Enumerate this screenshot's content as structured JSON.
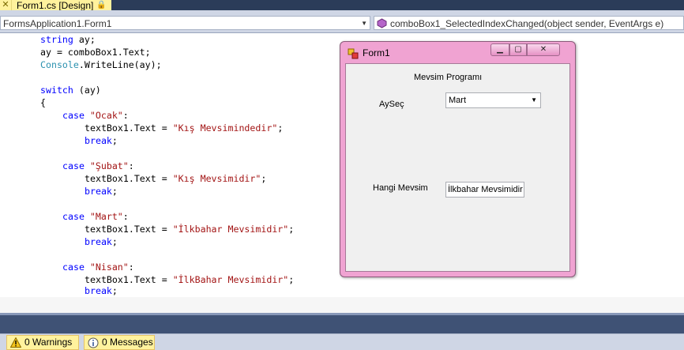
{
  "tab": {
    "close_glyph": "✕",
    "title": "Form1.cs [Design]",
    "lock_icon": "lock-icon"
  },
  "navbar": {
    "class_combo": "FormsApplication1.Form1",
    "member_combo": "comboBox1_SelectedIndexChanged(object sender, EventArgs e)"
  },
  "code": {
    "l1_kw": "string",
    "l1_rest": " ay;",
    "l2": "ay = comboBox1.Text;",
    "l3_typ": "Console",
    "l3_rest": ".WriteLine(ay);",
    "l4_kw": "switch",
    "l4_rest": " (ay)",
    "l5": "{",
    "case_kw": "case",
    "colon": ":",
    "assign": "textBox1.Text = ",
    "semi": ";",
    "break_kw": "break",
    "case1": "\"Ocak\"",
    "val1": "\"Kış Mevsimindedir\"",
    "case2": "\"Şubat\"",
    "val2": "\"Kış Mevsimidir\"",
    "case3": "\"Mart\"",
    "val3": "\"İlkbahar Mevsimidir\"",
    "case4": "\"Nisan\"",
    "val4": "\"İlkBahar Mevsimidir\""
  },
  "form": {
    "title": "Form1",
    "min_glyph": "▁",
    "max_glyph": "▢",
    "close_glyph": "✕",
    "heading": "Mevsim Programı",
    "ay_label": "AySeç",
    "combo_value": "Mart",
    "season_label": "Hangi Mevsim",
    "textbox_value": "İlkbahar Mevsimidir"
  },
  "errorlist": {
    "warnings": "0 Warnings",
    "messages": "0 Messages"
  },
  "colors": {
    "accent_tab": "#fff29d",
    "chrome_dark": "#2b3c59",
    "form_frame": "#f0a3d2"
  }
}
